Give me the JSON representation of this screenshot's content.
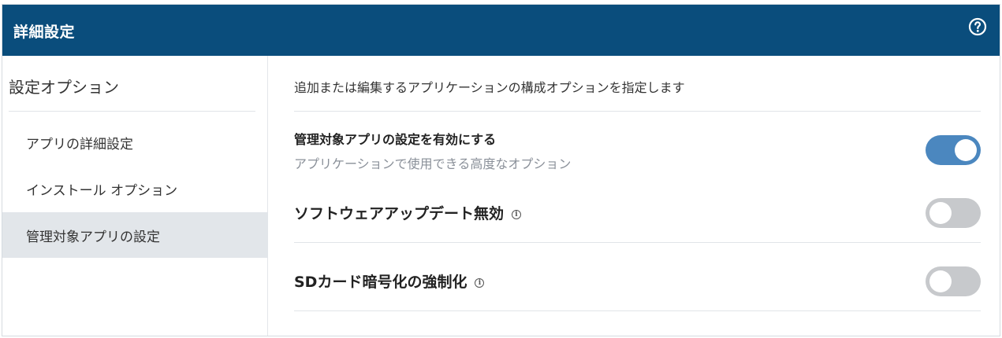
{
  "header": {
    "title": "詳細設定",
    "help_icon": "question-circle-icon",
    "background": "#0a4d7c"
  },
  "sidebar": {
    "heading": "設定オプション",
    "items": [
      {
        "label": "アプリの詳細設定",
        "active": false
      },
      {
        "label": "インストール オプション",
        "active": false
      },
      {
        "label": "管理対象アプリの設定",
        "active": true
      }
    ]
  },
  "main": {
    "description": "追加または編集するアプリケーションの構成オプションを指定します",
    "options": [
      {
        "title": "管理対象アプリの設定を有効にする",
        "subtitle": "アプリケーションで使用できる高度なオプション",
        "enabled": true,
        "has_info": false
      },
      {
        "title": "ソフトウェアアップデート無効",
        "enabled": false,
        "has_info": true
      },
      {
        "title": "SDカード暗号化の強制化",
        "enabled": false,
        "has_info": true
      }
    ]
  },
  "colors": {
    "toggle_on": "#4b87bf",
    "toggle_off": "#c7c9cc",
    "active_nav": "#e2e6ea"
  }
}
